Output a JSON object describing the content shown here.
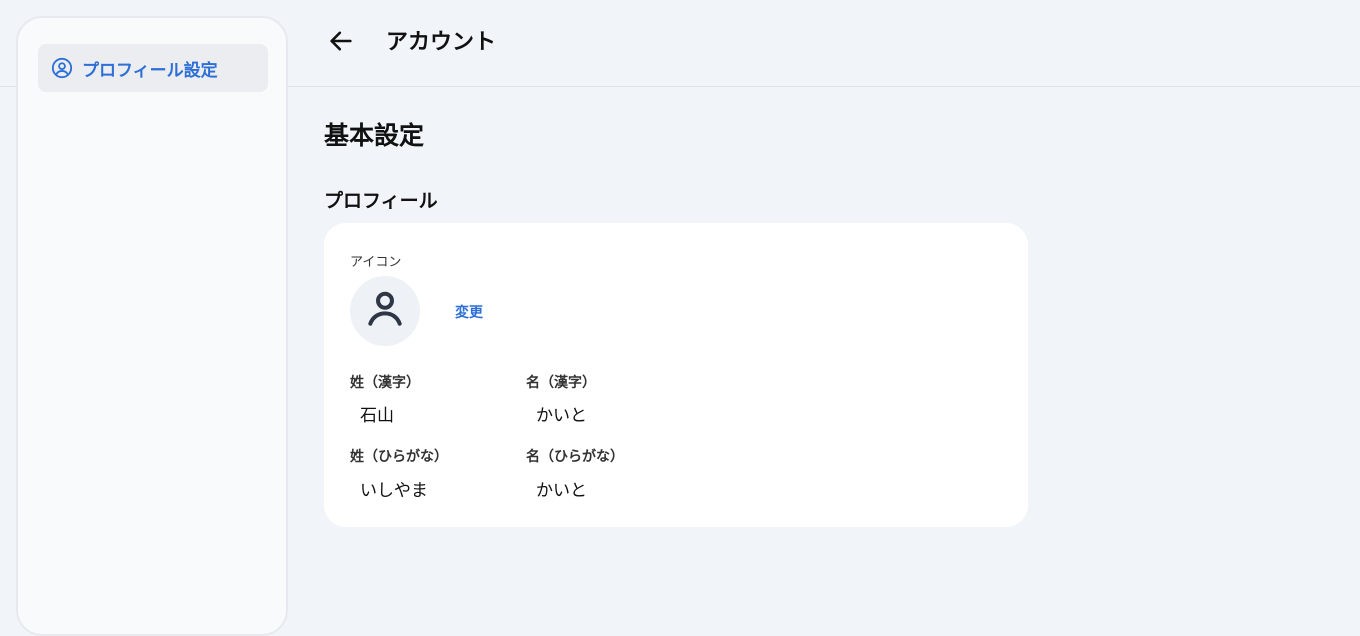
{
  "sidebar": {
    "items": [
      {
        "label": "プロフィール設定",
        "icon": "user-circle-icon",
        "active": true
      }
    ]
  },
  "header": {
    "back_icon": "arrow-left-icon",
    "title": "アカウント"
  },
  "main": {
    "section_title": "基本設定",
    "profile": {
      "title": "プロフィール",
      "icon_label": "アイコン",
      "avatar_icon": "user-icon",
      "change_label": "変更",
      "fields": [
        {
          "label": "姓（漢字）",
          "value": "石山"
        },
        {
          "label": "名（漢字）",
          "value": "かいと"
        },
        {
          "label": "姓（ひらがな）",
          "value": "いしやま"
        },
        {
          "label": "名（ひらがな）",
          "value": "かいと"
        }
      ]
    }
  },
  "colors": {
    "accent": "#2c6fd6",
    "background": "#f1f4f9",
    "card": "#ffffff",
    "sidebar": "#f8fafc"
  }
}
